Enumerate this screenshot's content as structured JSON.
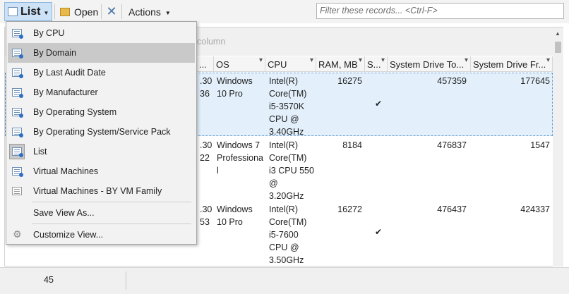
{
  "toolbar": {
    "list_label": "List",
    "open_label": "Open",
    "actions_label": "Actions",
    "filter_placeholder": "Filter these records... <Ctrl-F>"
  },
  "groupbar": {
    "hint_text": "column"
  },
  "columns": [
    {
      "label": "..."
    },
    {
      "label": "OS"
    },
    {
      "label": "CPU"
    },
    {
      "label": "RAM, MB"
    },
    {
      "label": "S..."
    },
    {
      "label": "System Drive To..."
    },
    {
      "label": "System Drive Fr..."
    }
  ],
  "rows": [
    {
      "ip_line1": ".30",
      "ip_line2": "36",
      "os": "Windows 10 Pro",
      "cpu": "Intel(R) Core(TM) i5-3570K CPU @ 3.40GHz",
      "ram": "16275",
      "checked": true,
      "drive_total": "457359",
      "drive_free": "177645"
    },
    {
      "ip_line1": ".30",
      "ip_line2": "22",
      "os": "Windows 7 Professional",
      "cpu": "Intel(R) Core(TM) i3 CPU 550 @ 3.20GHz",
      "ram": "8184",
      "checked": false,
      "drive_total": "476837",
      "drive_free": "1547"
    },
    {
      "ip_line1": ".30",
      "ip_line2": "53",
      "os": "Windows 10 Pro",
      "cpu": "Intel(R) Core(TM) i5-7600 CPU @ 3.50GHz",
      "ram": "16272",
      "checked": true,
      "drive_total": "476437",
      "drive_free": "424337"
    }
  ],
  "footer": {
    "record_count": "45"
  },
  "menu": {
    "items": [
      {
        "label": "By CPU",
        "icon": "view-grouped-icon"
      },
      {
        "label": "By Domain",
        "icon": "view-grouped-icon"
      },
      {
        "label": "By Last Audit Date",
        "icon": "view-grouped-icon"
      },
      {
        "label": "By Manufacturer",
        "icon": "view-grouped-icon"
      },
      {
        "label": "By Operating System",
        "icon": "view-grouped-icon"
      },
      {
        "label": "By Operating System/Service Pack",
        "icon": "view-grouped-icon"
      },
      {
        "label": "List",
        "icon": "view-grouped-icon"
      },
      {
        "label": "Virtual Machines",
        "icon": "view-grouped-icon"
      },
      {
        "label": "Virtual Machines - BY VM Family",
        "icon": "view-plain-icon"
      }
    ],
    "save_view_label": "Save View As...",
    "customize_view_label": "Customize View..."
  }
}
